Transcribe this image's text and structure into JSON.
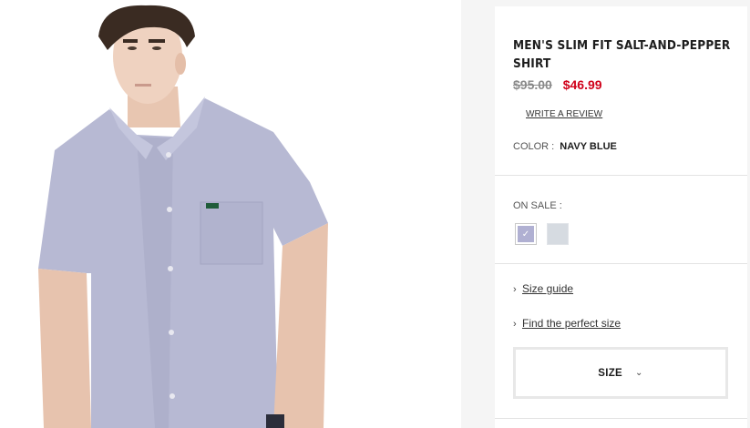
{
  "product": {
    "title": "MEN'S SLIM FIT SALT-AND-PEPPER SHIRT",
    "price_original": "$95.00",
    "price_sale": "$46.99",
    "write_review_label": "WRITE A REVIEW",
    "color_label": "COLOR :",
    "color_value": "NAVY BLUE"
  },
  "sale": {
    "label": "ON SALE :",
    "swatches": [
      {
        "name": "lavender",
        "color": "#b0b0d2",
        "selected": true
      },
      {
        "name": "light-grey",
        "color": "#d6dbe1",
        "selected": false
      }
    ]
  },
  "links": {
    "size_guide": "Size guide",
    "perfect_size": "Find the perfect size"
  },
  "size_selector": {
    "label": "SIZE",
    "icon": "chevron-down-icon"
  },
  "image": {
    "subject": "model-wearing-shirt",
    "shirt_color": "#b7b9d3",
    "logo_color": "#1f5c3a"
  }
}
